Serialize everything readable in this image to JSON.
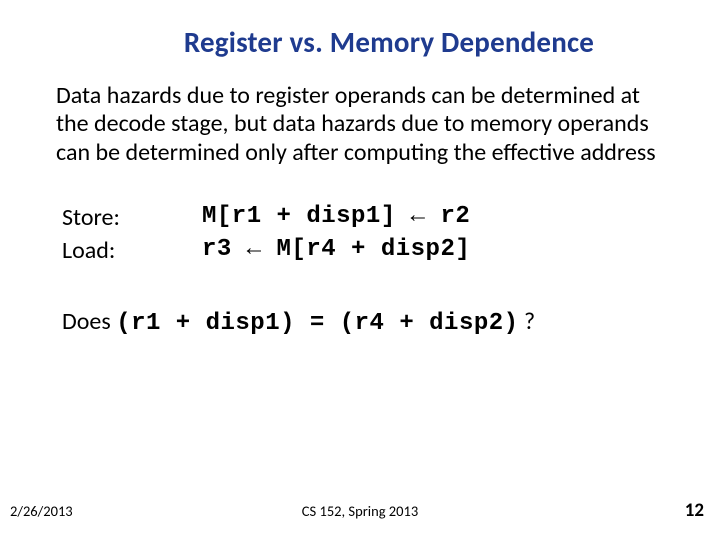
{
  "title": "Register vs. Memory Dependence",
  "paragraph": "Data hazards due to register operands can be determined at the decode stage, but data hazards due to memory operands can be determined only after computing the effective address",
  "rows": {
    "store_label": "Store:",
    "store_code": "M[r1 + disp1] ← r2",
    "load_label": "Load:",
    "load_code": "r3 ← M[r4 + disp2]"
  },
  "question_prefix": "Does ",
  "question_expr": "(r1 + disp1) = (r4 + disp2)",
  "question_suffix": " ?",
  "footer": {
    "date": "2/26/2013",
    "course": "CS 152, Spring 2013",
    "page": "12"
  }
}
